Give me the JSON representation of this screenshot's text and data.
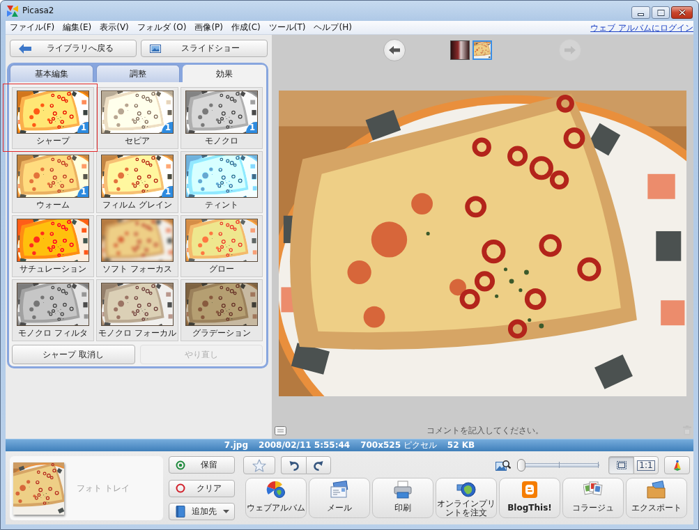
{
  "window": {
    "title": "Picasa2"
  },
  "menu": {
    "items": [
      "ファイル(F)",
      "編集(E)",
      "表示(V)",
      "フォルダ (O)",
      "画像(P)",
      "作成(C)",
      "ツール(T)",
      "ヘルプ(H)"
    ],
    "login_link": "ウェブ アルバムにログイン"
  },
  "edit_panel": {
    "nav_buttons": [
      {
        "label": "ライブラリへ戻る",
        "kind": "back"
      },
      {
        "label": "スライドショー",
        "kind": "slideshow"
      }
    ],
    "tabs": [
      {
        "label": "基本編集",
        "selected": false
      },
      {
        "label": "調整",
        "selected": false
      },
      {
        "label": "効果",
        "selected": true
      }
    ],
    "effects": [
      {
        "label": "シャープ",
        "kind": "sharpen",
        "badge": "1",
        "selected": true
      },
      {
        "label": "セピア",
        "kind": "sepia",
        "badge": "1",
        "selected": false
      },
      {
        "label": "モノクロ",
        "kind": "mono",
        "badge": "1",
        "selected": false
      },
      {
        "label": "ウォーム",
        "kind": "warm",
        "badge": "1",
        "selected": false
      },
      {
        "label": "フィルム グレイン",
        "kind": "grain",
        "badge": "1",
        "selected": false
      },
      {
        "label": "ティント",
        "kind": "tint",
        "selected": false
      },
      {
        "label": "サチュレーション",
        "kind": "saturation",
        "selected": false
      },
      {
        "label": "ソフト フォーカス",
        "kind": "soft-focus",
        "selected": false
      },
      {
        "label": "グロー",
        "kind": "glow",
        "selected": false
      },
      {
        "label": "モノクロ フィルタ",
        "kind": "mono-filter",
        "selected": false
      },
      {
        "label": "モノクロ フォーカル",
        "kind": "mono-focal",
        "selected": false
      },
      {
        "label": "グラデーション",
        "kind": "graduated",
        "selected": false
      }
    ],
    "buttons": [
      {
        "label": "シャープ 取消し",
        "disabled": false
      },
      {
        "label": "やり直し",
        "disabled": true
      }
    ]
  },
  "viewer": {
    "prev": {
      "disabled": false
    },
    "filmstrip": [
      {
        "kind": "restaurant",
        "selected": false
      },
      {
        "kind": "pizza",
        "selected": true
      }
    ],
    "next": {
      "disabled": true
    },
    "comment": {
      "placeholder": "コメントを記入してください。"
    }
  },
  "status_bar": {
    "items": [
      "**7.jpg**",
      "**2008/02/11 5:55:44**",
      "**700x525** ピクセル",
      "**52 KB**"
    ]
  },
  "photo_tray": {
    "label": "フォト トレイ"
  },
  "tray_buttons": [
    {
      "label": "保留",
      "kind": "hold"
    },
    {
      "label": "クリア",
      "kind": "clear"
    },
    {
      "label": "追加先",
      "kind": "add-to"
    }
  ],
  "toolbar": {
    "zoom": {
      "level": 0
    },
    "view_modes": [
      {
        "kind": "fit",
        "selected": true
      },
      {
        "kind": "actual",
        "label": "1:1",
        "selected": false
      }
    ]
  },
  "actions": [
    {
      "label": "ウェブアルバム",
      "kind": "web-album"
    },
    {
      "label": "メール",
      "kind": "email"
    },
    {
      "label": "印刷",
      "kind": "print"
    },
    {
      "label": "オンラインプリントを注文",
      "kind": "online-print"
    },
    {
      "label": "BlogThis!",
      "kind": "blog"
    },
    {
      "label": "コラージュ",
      "kind": "collage"
    },
    {
      "label": "エクスポート",
      "kind": "export"
    }
  ]
}
